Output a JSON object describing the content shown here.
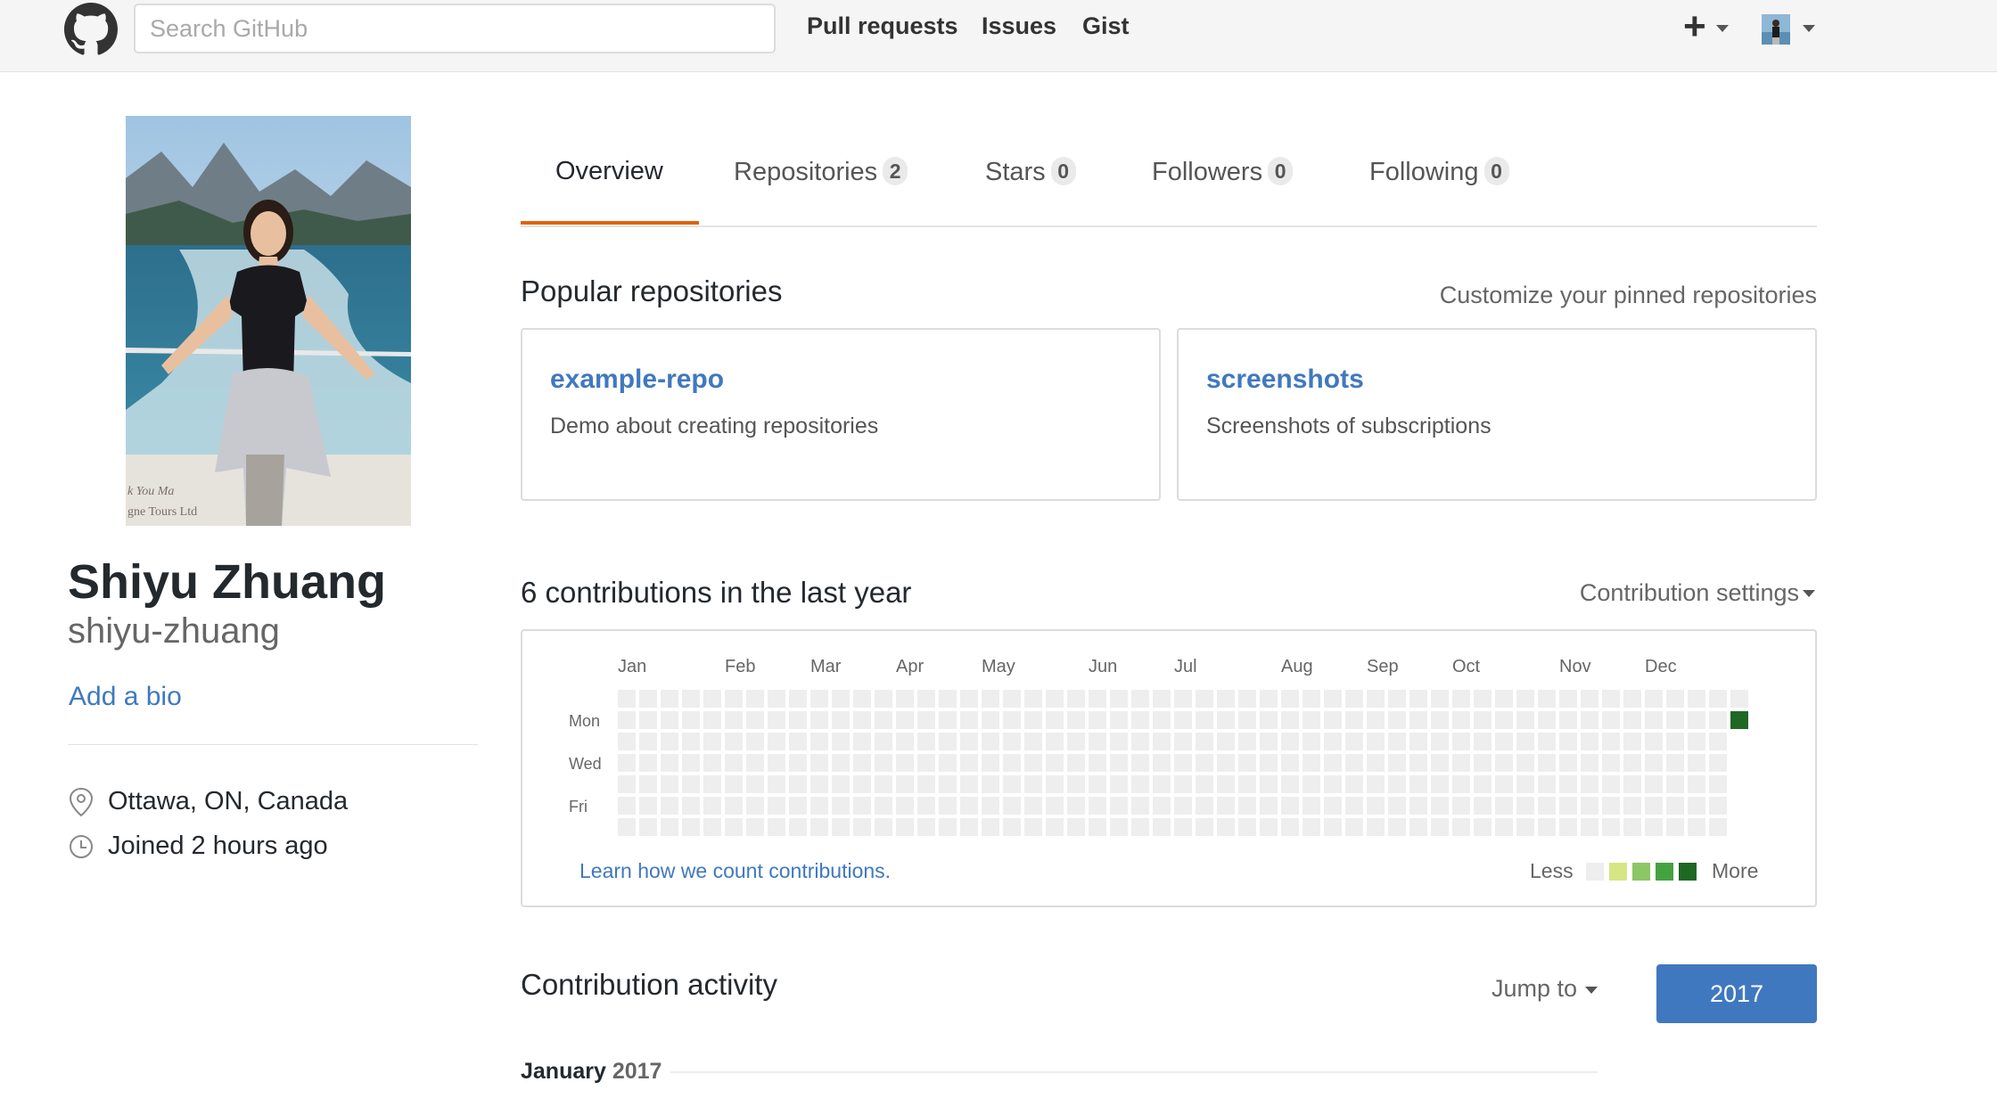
{
  "header": {
    "search_placeholder": "Search GitHub",
    "nav": [
      "Pull requests",
      "Issues",
      "Gist"
    ],
    "icons": [
      "github-logo-icon",
      "plus-icon",
      "chevron-down-icon"
    ]
  },
  "profile": {
    "full_name": "Shiyu Zhuang",
    "username": "shiyu-zhuang",
    "add_bio": "Add a bio",
    "location": "Ottawa, ON, Canada",
    "joined": "Joined 2 hours ago",
    "photo_watermark_line1": "k You    Ma",
    "photo_watermark_line2": "gne Tours Ltd"
  },
  "tabs": [
    {
      "label": "Overview",
      "count": null
    },
    {
      "label": "Repositories",
      "count": "2"
    },
    {
      "label": "Stars",
      "count": "0"
    },
    {
      "label": "Followers",
      "count": "0"
    },
    {
      "label": "Following",
      "count": "0"
    }
  ],
  "popular": {
    "title": "Popular repositories",
    "customize": "Customize your pinned repositories",
    "repos": [
      {
        "name": "example-repo",
        "description": "Demo about creating repositories"
      },
      {
        "name": "screenshots",
        "description": "Screenshots of subscriptions"
      }
    ]
  },
  "contributions": {
    "title": "6 contributions in the last year",
    "settings": "Contribution settings",
    "months": [
      "Jan",
      "Feb",
      "Mar",
      "Apr",
      "May",
      "Jun",
      "Jul",
      "Aug",
      "Sep",
      "Oct",
      "Nov",
      "Dec"
    ],
    "day_labels": [
      "Mon",
      "Wed",
      "Fri"
    ],
    "weeks": 53,
    "last_week_days": 2,
    "active_cell": {
      "week": 53,
      "day": 1,
      "level": 4
    },
    "learn_link": "Learn how we count contributions.",
    "legend_less": "Less",
    "legend_more": "More",
    "colors": [
      "#eeeeee",
      "#d6e685",
      "#8cc665",
      "#44a340",
      "#1e6823"
    ]
  },
  "activity": {
    "title": "Contribution activity",
    "jump_to": "Jump to",
    "year": "2017",
    "month_label": "January",
    "month_year": "2017"
  },
  "colors": {
    "link": "#4078c0",
    "tab_accent": "#e36209"
  }
}
